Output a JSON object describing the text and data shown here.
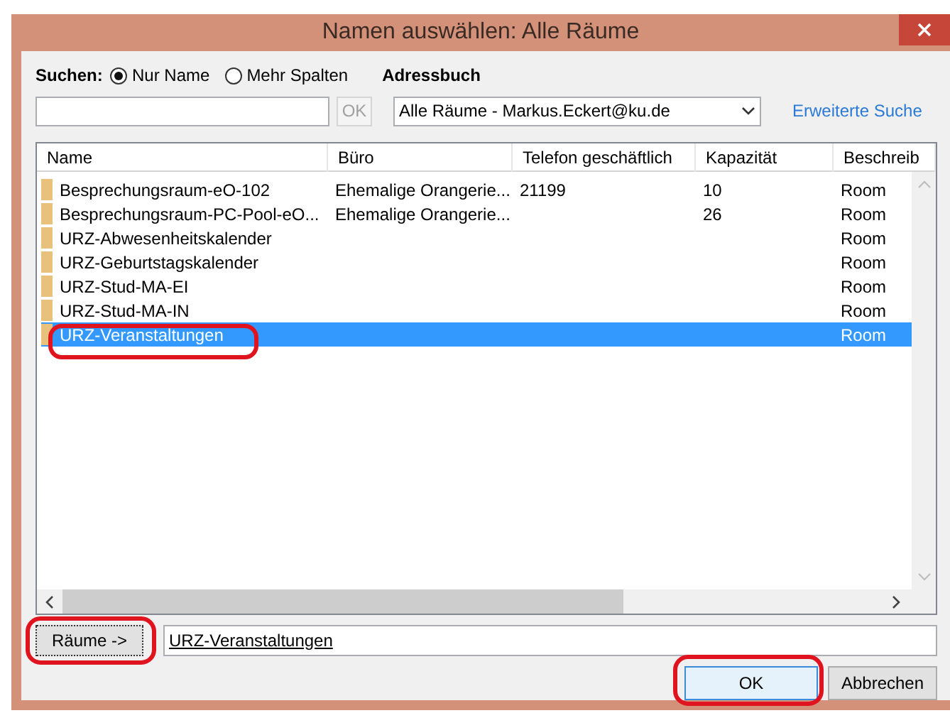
{
  "window": {
    "title": "Namen auswählen: Alle Räume"
  },
  "search": {
    "label": "Suchen:",
    "options": [
      {
        "label": "Nur Name",
        "selected": true
      },
      {
        "label": "Mehr Spalten",
        "selected": false
      }
    ],
    "go_button": {
      "label": "OK",
      "disabled": true
    }
  },
  "address_book": {
    "label": "Adressbuch",
    "value": "Alle Räume - Markus.Eckert@ku.de",
    "link": "Erweiterte Suche"
  },
  "table": {
    "columns": [
      "Name",
      "Büro",
      "Telefon geschäftlich",
      "Kapazität",
      "Beschreib"
    ],
    "rows": [
      {
        "cells": [
          "Besprechungsraum-eO-102",
          "Ehemalige Orangerie...",
          "21199",
          "10",
          "Room"
        ],
        "selected": false
      },
      {
        "cells": [
          "Besprechungsraum-PC-Pool-eO...",
          "Ehemalige Orangerie...",
          "",
          "26",
          "Room"
        ],
        "selected": false
      },
      {
        "cells": [
          "URZ-Abwesenheitskalender",
          "",
          "",
          "",
          "Room"
        ],
        "selected": false
      },
      {
        "cells": [
          "URZ-Geburtstagskalender",
          "",
          "",
          "",
          "Room"
        ],
        "selected": false
      },
      {
        "cells": [
          "URZ-Stud-MA-EI",
          "",
          "",
          "",
          "Room"
        ],
        "selected": false
      },
      {
        "cells": [
          "URZ-Stud-MA-IN",
          "",
          "",
          "",
          "Room"
        ],
        "selected": false
      },
      {
        "cells": [
          "URZ-Veranstaltungen",
          "",
          "",
          "",
          "Room"
        ],
        "selected": true
      }
    ]
  },
  "add": {
    "button": "Räume ->",
    "value": "URZ-Veranstaltungen"
  },
  "buttons": [
    {
      "label": "OK",
      "kind": "default"
    },
    {
      "label": "Abbrechen",
      "kind": "normal"
    }
  ]
}
